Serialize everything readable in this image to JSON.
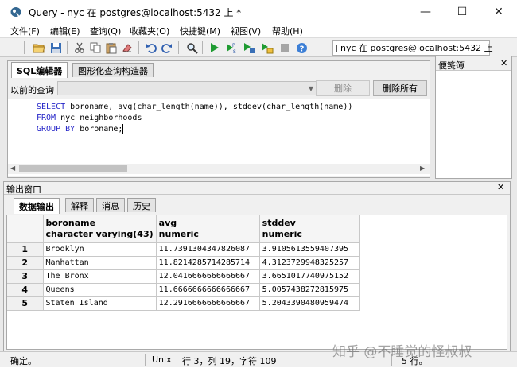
{
  "window": {
    "title": "Query - nyc 在  postgres@localhost:5432 上 *",
    "controls": {
      "minimize": "—",
      "maximize": "☐",
      "close": "✕"
    }
  },
  "menu": [
    "文件(F)",
    "编辑(E)",
    "查询(Q)",
    "收藏夹(O)",
    "快捷键(M)",
    "视图(V)",
    "帮助(H)"
  ],
  "toolbar": {
    "connection": "nyc 在  postgres@localhost:5432 上"
  },
  "editor": {
    "tabs": [
      "SQL编辑器",
      "图形化查询构造器"
    ],
    "active_tab": 0,
    "previous_queries_label": "以前的查询",
    "delete_button": "删除",
    "delete_all_button": "删除所有",
    "sql_lines": [
      {
        "kw": "SELECT",
        "rest": " boroname, avg(char_length(name)), stddev(char_length(name))"
      },
      {
        "kw": "FROM",
        "rest": " nyc_neighborhoods"
      },
      {
        "kw": "GROUP BY",
        "rest": " boroname;"
      }
    ]
  },
  "scratch_pad": {
    "title": "便笺簿",
    "close": "✕"
  },
  "output": {
    "title": "输出窗口",
    "close": "✕",
    "tabs": [
      "数据输出",
      "解释",
      "消息",
      "历史"
    ],
    "active_tab": 0,
    "columns": [
      {
        "name": "boroname",
        "type": "character varying(43)"
      },
      {
        "name": "avg",
        "type": "numeric"
      },
      {
        "name": "stddev",
        "type": "numeric"
      }
    ],
    "rows": [
      {
        "n": "1",
        "cells": [
          "Brooklyn",
          "11.7391304347826087",
          "3.9105613559407395"
        ]
      },
      {
        "n": "2",
        "cells": [
          "Manhattan",
          "11.8214285714285714",
          "4.3123729948325257"
        ]
      },
      {
        "n": "3",
        "cells": [
          "The Bronx",
          "12.0416666666666667",
          "3.6651017740975152"
        ]
      },
      {
        "n": "4",
        "cells": [
          "Queens",
          "11.6666666666666667",
          "5.0057438272815975"
        ]
      },
      {
        "n": "5",
        "cells": [
          "Staten Island",
          "12.2916666666666667",
          "5.2043390480959474"
        ]
      }
    ]
  },
  "status": {
    "message": "确定。",
    "line_ending": "Unix",
    "position": "行 3，列 19，字符 109",
    "rows": "5 行。"
  },
  "watermark": "知乎 @不睡觉的怪叔叔"
}
